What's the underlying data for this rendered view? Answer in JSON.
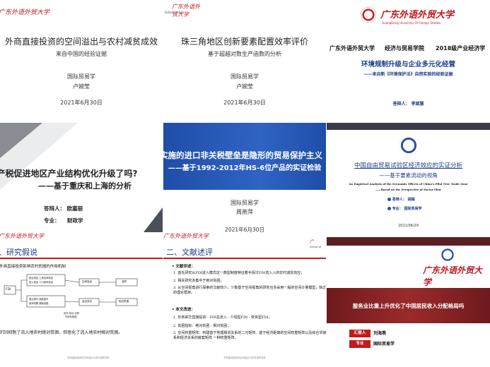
{
  "slides": {
    "s1": {
      "logo_text": "广东外语外贸大学",
      "logo_sub": "GUANGDONG UNIVERSITY OF FOREIGN STUDIES",
      "title": "外商直接投资的空间溢出与农村减贫成效",
      "subtitle": "来自中国的经验证据",
      "dept": "国际贸易学",
      "name": "卢婉莹",
      "date": "2021年6月30日"
    },
    "s2": {
      "logo_school": "School of Eco",
      "logo_text": "广东外语外贸大学",
      "title": "珠三角地区创新要素配置效率评价",
      "subtitle": "基于超越对数生产函数的分析",
      "dept": "国际贸易学",
      "name": "卢婉莹",
      "date": "2021年6月30日"
    },
    "s3": {
      "logo_text": "广东外语外贸大学",
      "logo_en": "GuangDong University Of Foreign Studies",
      "header": [
        "广东外语外贸大学",
        "经济与贸易学院",
        "2018级产业经济学"
      ],
      "title": "环境规制升级与企业多元化经营",
      "subtitle": "——来自新《环境保护法》自然实验的经验证据",
      "presenter": "答辩人：  李斌慧"
    },
    "s4": {
      "title1": "产税促进地区产业结构优化升级了吗?",
      "title2": "——基于重庆和上海的分析",
      "presenter": "答辩人：  欧嘉丽",
      "major": "专业：    财政学"
    },
    "s5": {
      "title1": "实施的进口非关税壁垒是隐形的贸易保护主义",
      "title2": "——基于1992-2012年HS-6位产品的实证检验",
      "dept": "国际贸易学",
      "name": "周燕萍",
      "date": "2021年6月30日"
    },
    "s6": {
      "title": "中国自由贸易试验区经济效应的实证分析",
      "subtitle": "——基于要素流动的视角",
      "en_title": "An Empirical Analysis of the Economic Effects of China's Pilot Free Trade Zone",
      "en_sub": "——Based on the Perspective of Factor Flow",
      "presenter": "答辩人：  胡嫣",
      "major": "专业：  国际贸易学",
      "date": "2021/06/29"
    },
    "s7": {
      "logo_text": "广东外语外贸大学",
      "section": "、研究假说",
      "sub": "1.外商直接投资影响农村贫困的作用机制",
      "node_fdi": "FDI",
      "nodes": [
        "就业效应  工资总体效应",
        "收入效应  人力资本效应",
        "就业提升  技能提升",
        "资本积累  基础设施",
        "增长效应",
        "空间溢出",
        "减贫",
        "相对贫困",
        "农户生活水平",
        "溢出效应",
        "减贫效应"
      ],
      "caption1": "资本/劳动 对照",
      "caption2": "作用机制图",
      "body": "，FDI抑制了流入地农村绝对贫困，但恶化了流入地农村相对贫困。",
      "footer": "外商直接投资的空间溢出与农村减贫成效"
    },
    "s8": {
      "logo_text": "广东外语外贸大学",
      "logo_school": "School of",
      "section": "二、文献述评",
      "review_head": "• 文献评述：",
      "items": [
        "1.  首先研究从FDI进入模式这一典型制度特征着手探讨FDI流入入的农村减贫效应；",
        "2.  相关研究多集中于绝对贫困；",
        "3.  从空间视角进行探索的文献较少，少数基于空间视角的研究也多采用一般的空间计量模型，缺乏系统的理论框架。"
      ],
      "improve_head": "• 本文改进：",
      "improve_items": [
        "1.  外商来华直接投资：FDI总流入 - 介绍型FDI - 依资型FDI；",
        "2.  贫困指标：绝对贫困 - 相对贫困；",
        "3.  空间权重矩阵：构建基于地理相邻关系的二元矩阵、基于经济距离的空间权重矩阵以及综合邻接关系和经济关系的嵌套矩阵 一种权重矩阵。"
      ],
      "footer": "外商直接投资的空间溢出与农村减贫成效"
    },
    "s9": {
      "logo_text": "广东外语外贸大学",
      "title": "服务业比重上升优化了中国居民收入分配格局吗",
      "reporter_label": "汇报人",
      "reporter": "刘海燕",
      "major_label": "专业",
      "major": "国际贸易学"
    }
  },
  "colors": {
    "red": "#c41a1a",
    "navy": "#1a3a8a",
    "blue_band": "#2457b8",
    "dark_bg": "#3a3a48",
    "maroon": "#7a1c1c"
  }
}
